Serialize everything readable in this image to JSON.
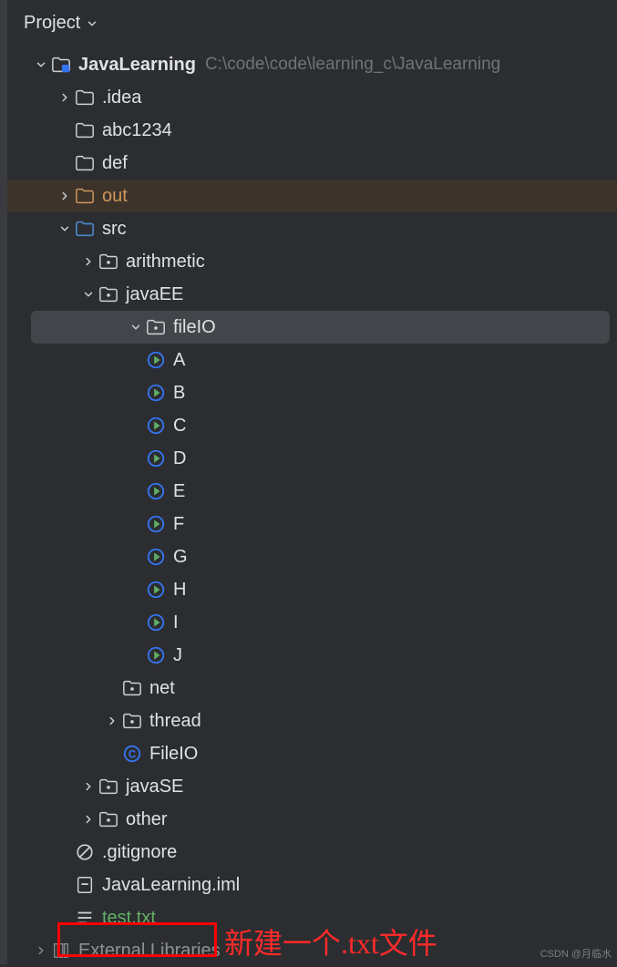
{
  "panel": {
    "title": "Project"
  },
  "root": {
    "name": "JavaLearning",
    "path": "C:\\code\\code\\learning_c\\JavaLearning"
  },
  "items": {
    "idea": ".idea",
    "abc": "abc1234",
    "def": "def",
    "out": "out",
    "src": "src",
    "arithmetic": "arithmetic",
    "javaEE": "javaEE",
    "fileIO": "fileIO",
    "classes": [
      "A",
      "B",
      "C",
      "D",
      "E",
      "F",
      "G",
      "H",
      "I",
      "J"
    ],
    "net": "net",
    "thread": "thread",
    "FileIOclass": "FileIO",
    "javaSE": "javaSE",
    "other": "other",
    "gitignore": ".gitignore",
    "iml": "JavaLearning.iml",
    "test": "test.txt",
    "extlib": "External Libraries"
  },
  "annotation": "新建一个.txt文件",
  "watermark": "CSDN @月临水"
}
